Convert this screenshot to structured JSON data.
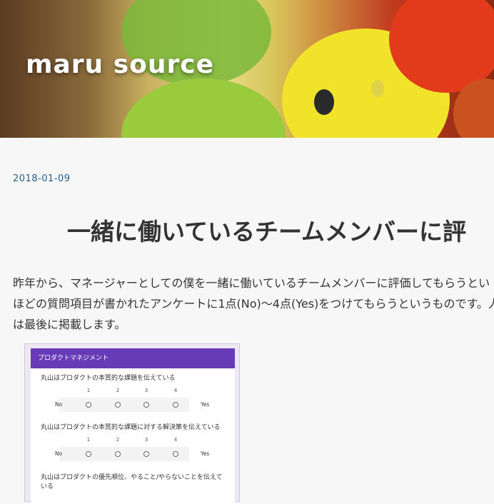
{
  "header": {
    "site_title": "maru source"
  },
  "post": {
    "date": "2018-01-09",
    "title": "一緒に働いているチームメンバーに評",
    "body_lines": [
      "昨年から、マネージャーとしての僕を一緒に働いているチームメンバーに評価してもらうとい",
      "ほどの質問項目が書かれたアンケートに1点(No)〜4点(Yes)をつけてもらうというものです。人",
      "は最後に掲載します。"
    ]
  },
  "form": {
    "section_title": "プロダクトマネジメント",
    "scale": [
      "1",
      "2",
      "3",
      "4"
    ],
    "low_label": "No",
    "high_label": "Yes",
    "questions": [
      "丸山はプロダクトの本質的な課題を伝えている",
      "丸山はプロダクトの本質的な課題に対する解決策を伝えている",
      "丸山はプロダクトの優先順位、やること/やらないことを伝えている"
    ]
  }
}
